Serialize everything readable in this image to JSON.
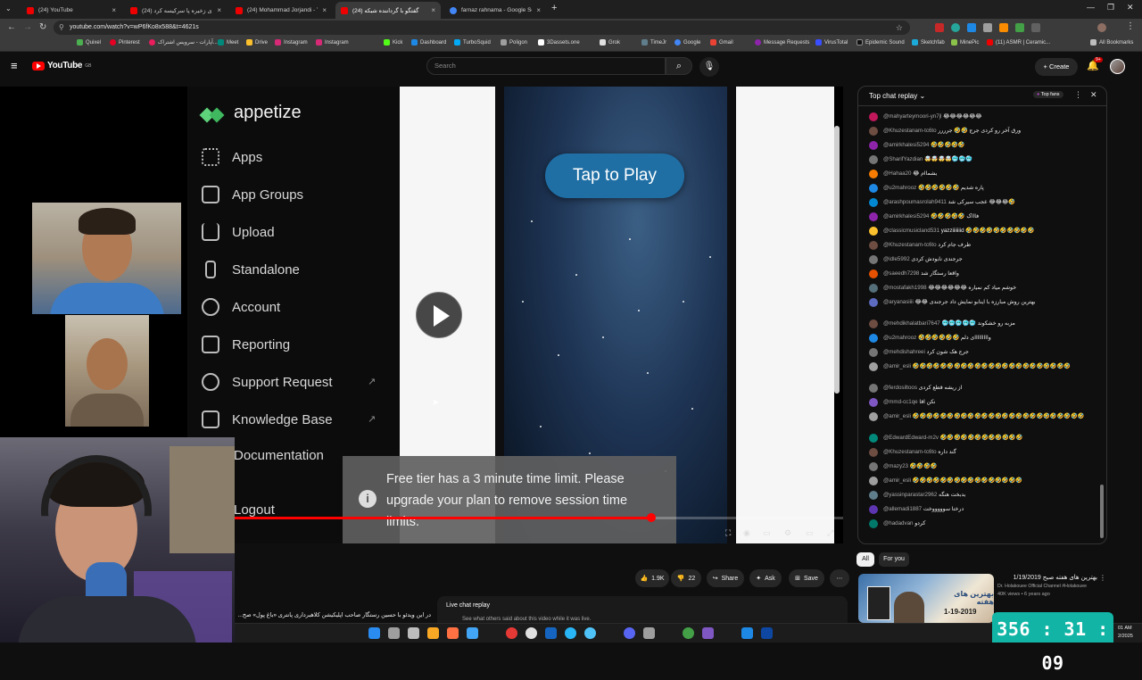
{
  "browser": {
    "tabs": [
      {
        "label": "(24) YouTube",
        "active": false
      },
      {
        "label": "(24) شقهای زخیره پا سرکیسه کرد...",
        "active": false
      },
      {
        "label": "(24) Mohammad Jorjandi - You...",
        "active": false
      },
      {
        "label": "(24) گفتگو با گرداننده شبکه",
        "active": true
      },
      {
        "label": "farnaz rahnama - Google Search",
        "active": false
      }
    ],
    "url": "youtube.com/watch?v=wP6fKo8x588&t=4621s",
    "bookmarks": [
      "Quixel",
      "Pinterest",
      "آپارات - سرویس اشتراک...",
      "Meet",
      "Drive",
      "Instagram",
      "Instagram",
      "Kick",
      "Dashboard",
      "TurboSquid",
      "Poligon",
      "3Dassets.one",
      "Grok",
      "TimeJr",
      "Google",
      "Gmail",
      "Message Requests",
      "VirusTotal",
      "Epidemic Sound",
      "Sketchfab",
      "MinePic",
      "(11) ASMR | Ceramic..."
    ],
    "all_bookmarks": "All Bookmarks"
  },
  "youtube": {
    "logo": "YouTube",
    "country": "GB",
    "search_placeholder": "Search",
    "create_label": "Create",
    "notif_count": "9+"
  },
  "appetize": {
    "brand": "appetize",
    "menu": [
      "Apps",
      "App Groups",
      "Upload",
      "Standalone",
      "Account",
      "Reporting",
      "Support Request",
      "Knowledge Base",
      "Documentation",
      "Logout"
    ],
    "tap_to_play": "Tap to Play",
    "toast": "Free tier has a 3 minute time limit. Please upgrade your plan to remove session time limits."
  },
  "player": {
    "progress_fraction": 0.685
  },
  "chat": {
    "title": "Top chat replay",
    "top_fans": "Top fans",
    "messages": [
      {
        "author": "@mahyarteymoori-yn7jl",
        "text": "😂😂😂😂😂😂",
        "color": "#c2185b"
      },
      {
        "author": "@Khuzestanam-tc6to",
        "text": "ورق آخر رو کردی جرج 🤣🤣 جرررر",
        "color": "#6d4c41"
      },
      {
        "author": "@amirkhalesi5294",
        "text": "🤣🤣🤣🤣🤣",
        "color": "#8e24aa"
      },
      {
        "author": "@SharifYazdian",
        "text": "🤯🤯🤯🤯🥶🥶🥶",
        "color": "#757575"
      },
      {
        "author": "@Hahaa20",
        "text": "😂 بشماام",
        "color": "#f57c00"
      },
      {
        "author": "@u2mahrooz",
        "text": "🤣🤣🤣🤣🤣🤣 پاره شدیم",
        "color": "#1e88e5"
      },
      {
        "author": "@arashpoumasrolah9411",
        "text": "عجب سیرکی شد 😂😂😂🤣",
        "color": "#0288d1"
      },
      {
        "author": "@amirkhalesi5294",
        "text": "🤣🤣🤣🤣🤣 فاااک",
        "color": "#8e24aa"
      },
      {
        "author": "@classicmusicland531",
        "text": "yazziiiiiiid 🤣🤣🤣🤣🤣🤣🤣🤣🤣🤣",
        "color": "#fbc02d"
      },
      {
        "author": "@Khuzestanam-tc6to",
        "text": "طرف جام کرد",
        "color": "#6d4c41"
      },
      {
        "author": "@idle5992",
        "text": "جرجندی نابودش کردی",
        "color": "#757575"
      },
      {
        "author": "@saeedh7298",
        "text": "واقعا رستگار شد",
        "color": "#e65100"
      },
      {
        "author": "@mostafakh1998",
        "text": "😂😂😂😂😂😂 خوشم میاد کم نمیاره",
        "color": "#546e7a"
      },
      {
        "author": "@aryanasiiii",
        "text": "😂😂 بهترین روش مبارزه با اینابو نمایش داد جرجندی",
        "color": "#5c6bc0"
      },
      {
        "author": "@mehdikhalatbari7647",
        "text": "🥶🥶🥶🥶🥶 مزبه رو خشکوند",
        "color": "#6d4c41"
      },
      {
        "author": "@u2mahrooz",
        "text": "🤣🤣🤣🤣🤣🤣 وااااااااای دلم",
        "color": "#1e88e5"
      },
      {
        "author": "@mehdishahreei",
        "text": "جرج هک شون کرد",
        "color": "#757575"
      },
      {
        "author": "@amir_esli",
        "text": "🤣🤣🤣🤣🤣🤣🤣🤣🤣🤣🤣🤣🤣🤣🤣🤣🤣🤣🤣🤣🤣🤣🤣",
        "color": "#9e9e9e"
      },
      {
        "author": "@ferdosiltoos",
        "text": "از ریشه قطع کردی",
        "color": "#757575"
      },
      {
        "author": "@mmd-cc1qe",
        "text": "نکن اقا",
        "color": "#7e57c2"
      },
      {
        "author": "@amir_esli",
        "text": "🤣🤣🤣🤣🤣🤣🤣🤣🤣🤣🤣🤣🤣🤣🤣🤣🤣🤣🤣🤣🤣🤣🤣🤣🤣",
        "color": "#9e9e9e"
      },
      {
        "author": "@EdwardEdward-m2v",
        "text": "🤣🤣🤣🤣🤣🤣🤣🤣🤣🤣🤣🤣",
        "color": "#00897b"
      },
      {
        "author": "@Khuzestanam-tc6to",
        "text": "گند داره",
        "color": "#6d4c41"
      },
      {
        "author": "@mazy23",
        "text": "🤣🤣🤣🤣",
        "color": "#757575"
      },
      {
        "author": "@amir_esli",
        "text": "🤣🤣🤣🤣🤣🤣🤣🤣🤣🤣🤣🤣🤣🤣🤣🤣",
        "color": "#9e9e9e"
      },
      {
        "author": "@yassinparastar2962",
        "text": "بدبخت هنگه",
        "color": "#607d8b"
      },
      {
        "author": "@allemadi1887",
        "text": "درختا سوووووخت",
        "color": "#5e35b1"
      },
      {
        "author": "@hadadvan",
        "text": "کردو",
        "color": "#00796b"
      }
    ]
  },
  "actions": {
    "likes": "1.9K",
    "dislikes": "22",
    "share": "Share",
    "ask": "Ask",
    "save": "Save"
  },
  "below_player": {
    "video_title": "در این ویدئو با حسین رستگار صاحب اپلیکیشن کلاهبرداری پانتری «باغ پول» صح...",
    "live_chat_replay": "Live chat replay",
    "live_chat_sub": "See what others said about this video while it was live."
  },
  "recommended": {
    "chips": [
      "All",
      "For you"
    ],
    "title": "بهترین های هفته صبح 1/19/2019",
    "channel": "Dr. Holakouee Official Channel #Holakouee",
    "meta": "40K views • 6 years ago",
    "thumb_text": "بهترین های هفته",
    "thumb_date": "1-19-2019"
  },
  "overlay_timer": "356 : 31 : 09",
  "taskbar_clock": {
    "time": "01 AM",
    "date": "2/2025"
  }
}
